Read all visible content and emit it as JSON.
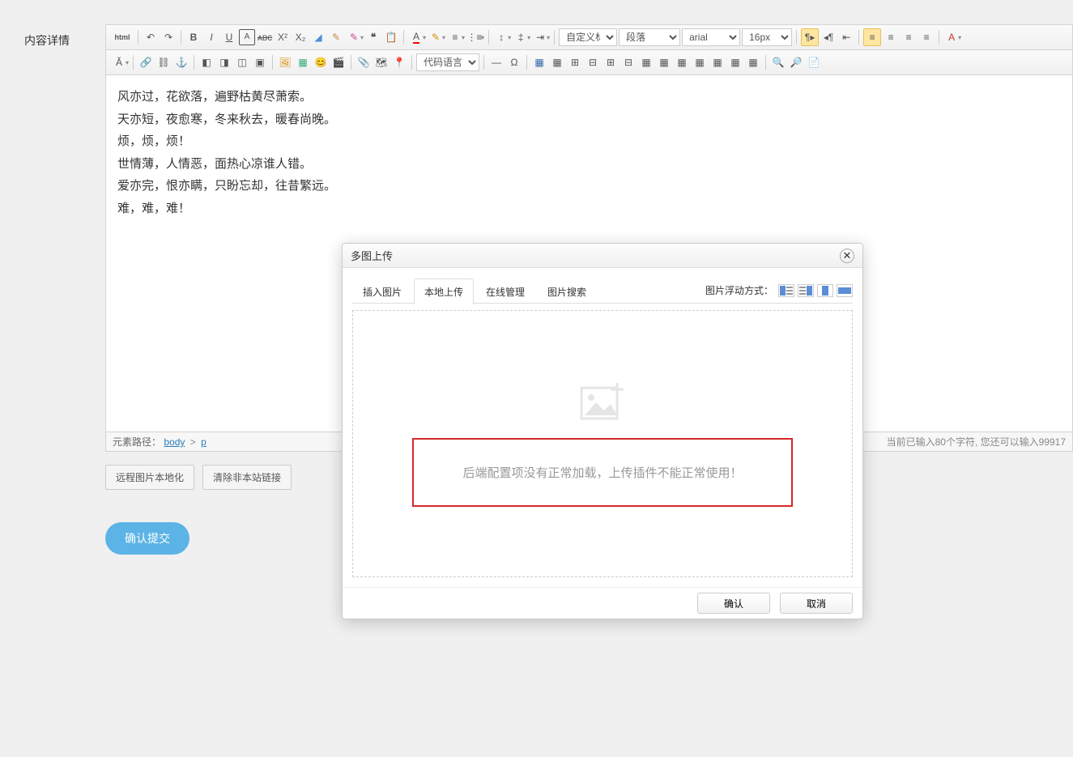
{
  "label": "内容详情",
  "toolbar": {
    "html": "html",
    "heading_sel": "自定义标题",
    "para_sel": "段落",
    "font_sel": "arial",
    "size_sel": "16px",
    "code_sel": "代码语言"
  },
  "content": {
    "p1": "风亦过，花欲落，遍野枯黄尽萧索。",
    "p2": "天亦短，夜愈寒，冬来秋去，暖春尚晚。",
    "p3": "烦，烦，烦！",
    "p4": "世情薄，人情恶，面热心凉谁人错。",
    "p5": "爱亦完，恨亦瞒，只盼忘却，往昔繁远。",
    "p6": "难，难，难！"
  },
  "status": {
    "path_label": "元素路径：",
    "path_body": "body",
    "path_p": "p",
    "counter": "当前已输入80个字符, 您还可以输入99917"
  },
  "buttons": {
    "localize": "远程图片本地化",
    "clear_links": "清除非本站链接",
    "submit": "确认提交"
  },
  "dialog": {
    "title": "多图上传",
    "tabs": {
      "t1": "插入图片",
      "t2": "本地上传",
      "t3": "在线管理",
      "t4": "图片搜索"
    },
    "float_label": "图片浮动方式：",
    "error": "后端配置项没有正常加载，上传插件不能正常使用！",
    "ok": "确认",
    "cancel": "取消"
  }
}
